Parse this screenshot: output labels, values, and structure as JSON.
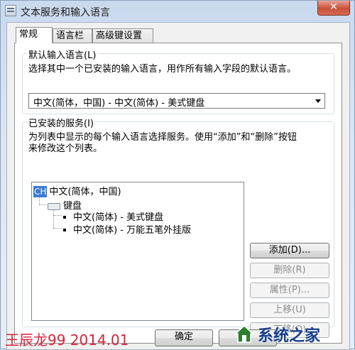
{
  "window": {
    "title": "文本服务和输入语言",
    "close_glyph": "✕"
  },
  "tabs": [
    {
      "label": "常规",
      "active": true
    },
    {
      "label": "语言栏",
      "active": false
    },
    {
      "label": "高级键设置",
      "active": false
    }
  ],
  "default_language": {
    "group_label": "默认输入语言(L)",
    "description": "选择其中一个已安装的输入语言，用作所有输入字段的默认语言。",
    "selected": "中文(简体，中国) - 中文(简体) - 美式键盘"
  },
  "installed_services": {
    "group_label": "已安装的服务(I)",
    "description_line1": "为列表中显示的每个输入语言选择服务。使用“添加”和“删除”按钮",
    "description_line2": "来修改这个列表。",
    "tree": {
      "language_badge": "CH",
      "language_name": "中文(简体，中国)",
      "category": "键盘",
      "items": [
        "中文(简体) - 美式键盘",
        "中文(简体) - 万能五笔外挂版"
      ]
    },
    "buttons": {
      "add": "添加(D)...",
      "remove": "删除(R)",
      "properties": "属性(P)...",
      "move_up": "上移(U)",
      "move_down": "下移(O)"
    }
  },
  "footer": {
    "ok_label": "确定",
    "watermark_left": "王辰龙99 2014.01",
    "brand_text": "系统之家"
  },
  "colors": {
    "accent": "#3a7bd5",
    "watermark_red": "#d8233a",
    "brand_blue": "#163c8a"
  }
}
